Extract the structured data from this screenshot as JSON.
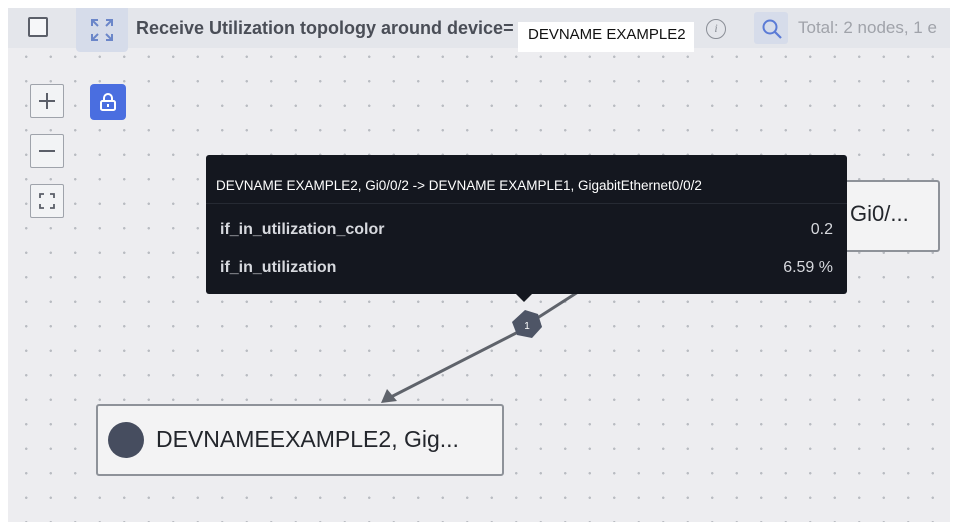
{
  "header": {
    "title": "Receive Utilization topology around device=",
    "device": "DEVNAME EXAMPLE2",
    "total": "Total: 2 nodes, 1 e"
  },
  "tooltip": {
    "heading": "DEVNAME EXAMPLE2, Gi0/0/2 -> DEVNAME EXAMPLE1, GigabitEthernet0/0/2",
    "rows": [
      {
        "key": "if_in_utilization_color",
        "value": "0.2"
      },
      {
        "key": "if_in_utilization",
        "value": "6.59 %"
      }
    ]
  },
  "nodes": {
    "right_label": "Gi0/...",
    "left_label": "DEVNAMEEXAMPLE2, Gig..."
  },
  "edge": {
    "badge": "1"
  },
  "colors": {
    "accent": "#4a6ee0",
    "tooltip_bg": "#14171f",
    "node_dot": "#464d5f",
    "canvas_bg": "#ededf0"
  },
  "icons": {
    "select": "checkbox-icon",
    "expand": "expand-icon",
    "info": "info-icon",
    "search": "search-icon",
    "zoom_in": "plus-icon",
    "zoom_out": "minus-icon",
    "fit": "fit-screen-icon",
    "lock": "lock-icon"
  }
}
